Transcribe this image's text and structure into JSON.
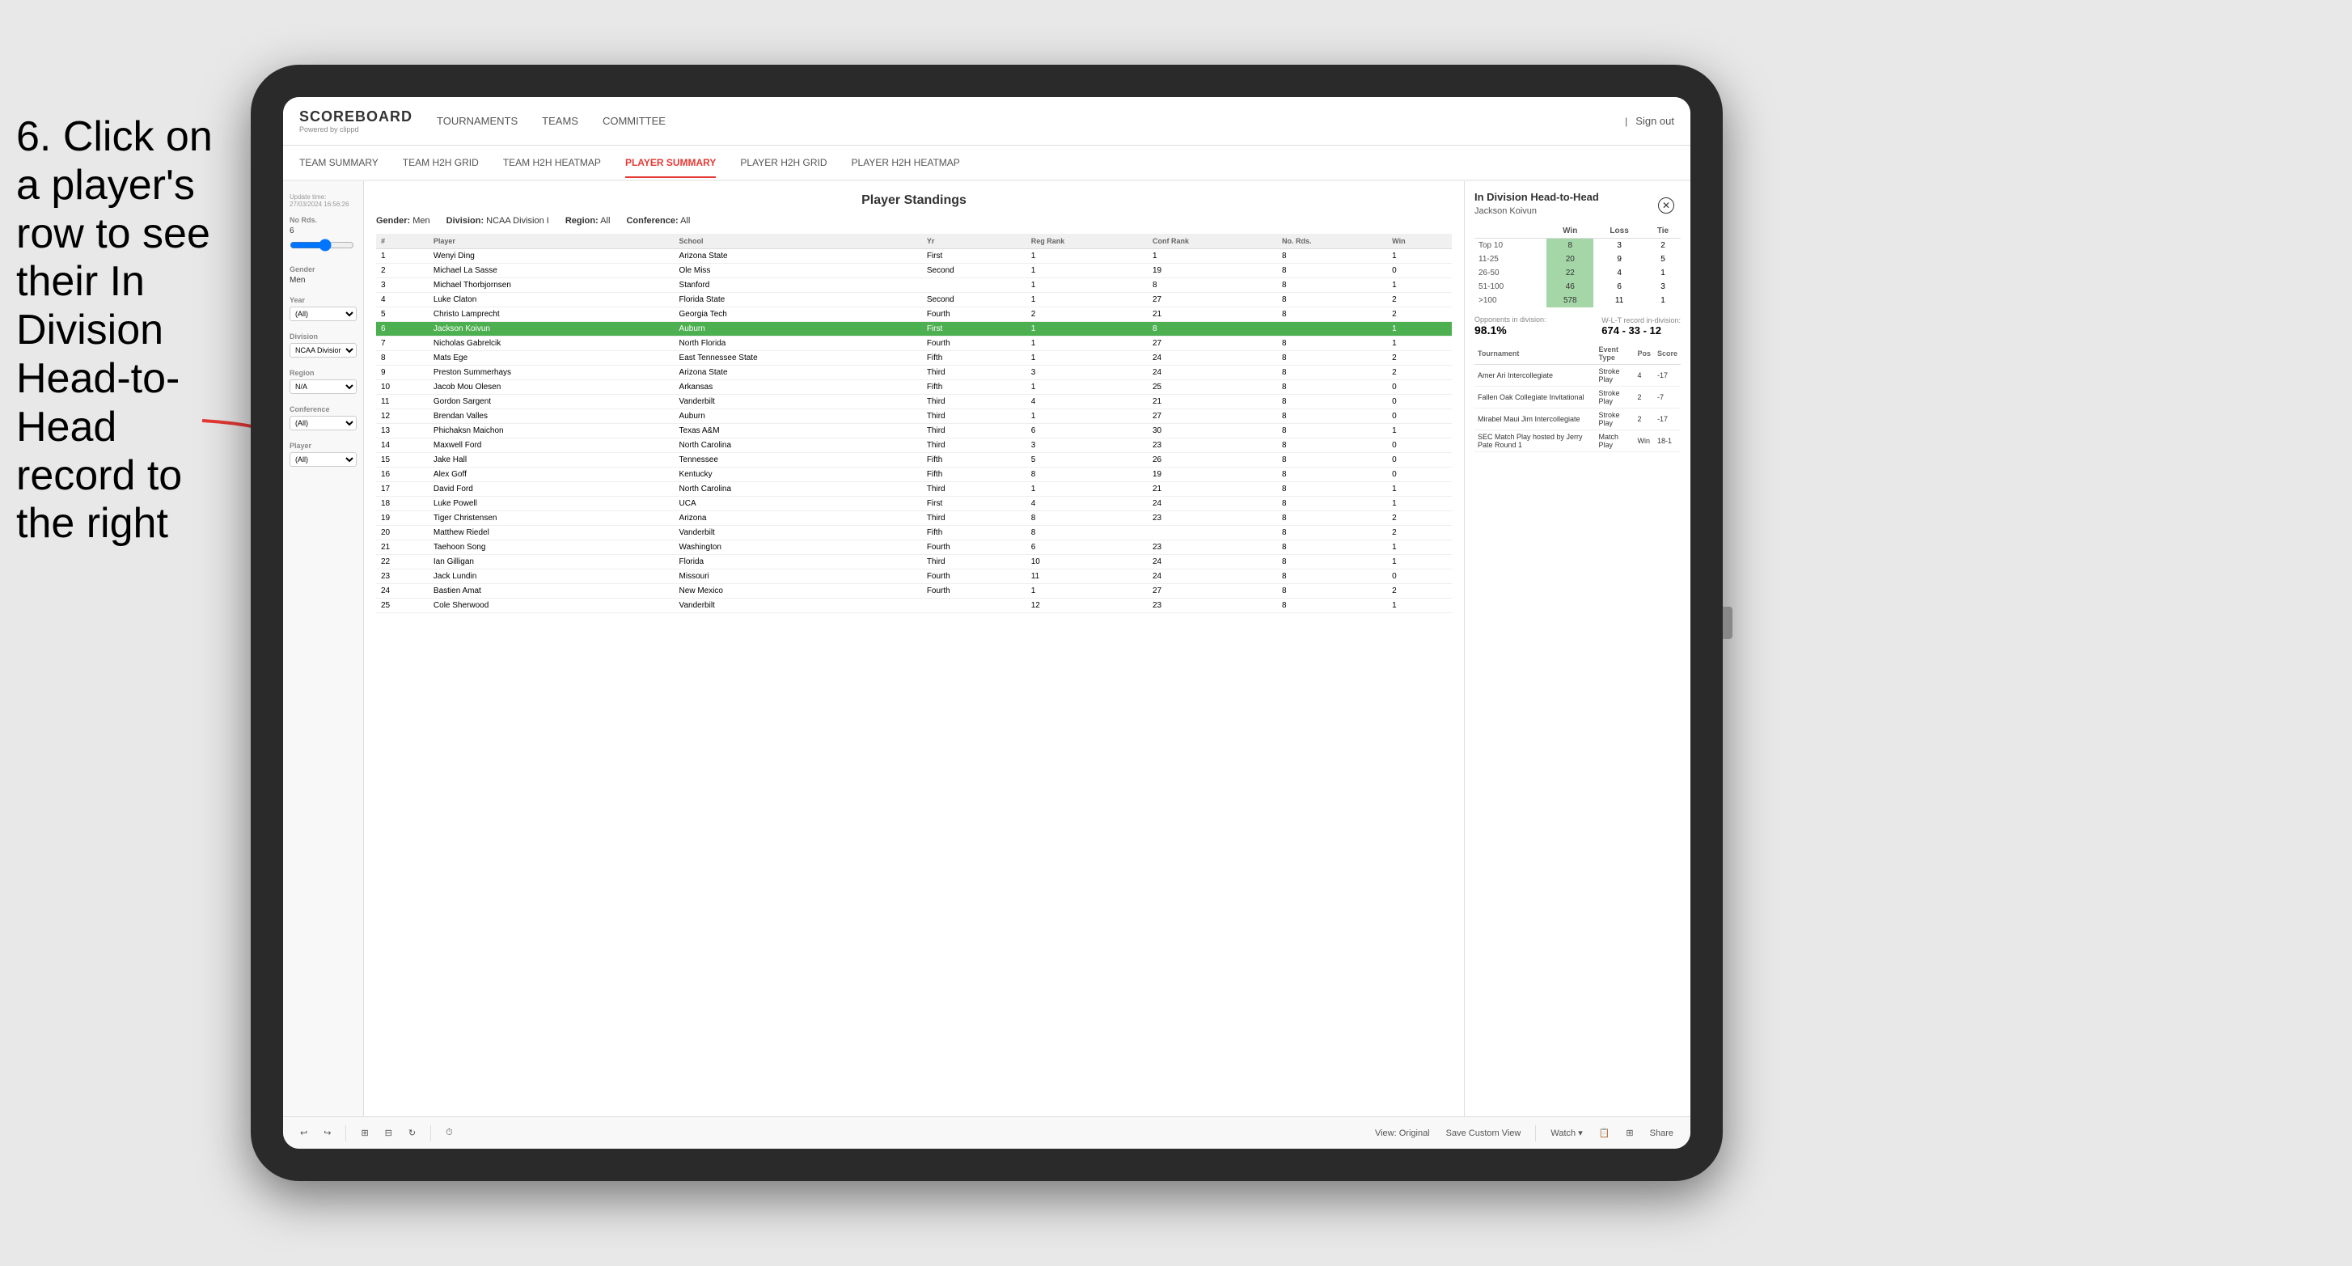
{
  "instruction": {
    "text": "6. Click on a player's row to see their In Division Head-to-Head record to the right"
  },
  "nav": {
    "logo": "SCOREBOARD",
    "logo_sub": "Powered by clippd",
    "items": [
      "TOURNAMENTS",
      "TEAMS",
      "COMMITTEE"
    ],
    "sign_out": "Sign out"
  },
  "sub_nav": {
    "items": [
      "TEAM SUMMARY",
      "TEAM H2H GRID",
      "TEAM H2H HEATMAP",
      "PLAYER SUMMARY",
      "PLAYER H2H GRID",
      "PLAYER H2H HEATMAP"
    ],
    "active": "PLAYER SUMMARY"
  },
  "sidebar": {
    "update_label": "Update time:",
    "update_time": "27/03/2024 16:56:26",
    "no_rds_label": "No Rds.",
    "no_rds_value": "6",
    "gender_label": "Gender",
    "gender_value": "Men",
    "year_label": "Year",
    "year_value": "(All)",
    "division_label": "Division",
    "division_value": "NCAA Division I",
    "region_label": "Region",
    "region_value": "N/A",
    "conference_label": "Conference",
    "conference_value": "(All)",
    "player_label": "Player",
    "player_value": "(All)"
  },
  "standings": {
    "title": "Player Standings",
    "gender_label": "Gender:",
    "gender_value": "Men",
    "division_label": "Division:",
    "division_value": "NCAA Division I",
    "region_label": "Region:",
    "region_value": "All",
    "conference_label": "Conference:",
    "conference_value": "All",
    "columns": [
      "#",
      "Player",
      "School",
      "Yr",
      "Reg Rank",
      "Conf Rank",
      "No. Rds.",
      "Win"
    ],
    "rows": [
      {
        "num": 1,
        "player": "Wenyi Ding",
        "school": "Arizona State",
        "yr": "First",
        "reg": 1,
        "conf": 1,
        "rds": 8,
        "win": 1
      },
      {
        "num": 2,
        "player": "Michael La Sasse",
        "school": "Ole Miss",
        "yr": "Second",
        "reg": 1,
        "conf": 19,
        "rds": 8,
        "win": 0
      },
      {
        "num": 3,
        "player": "Michael Thorbjornsen",
        "school": "Stanford",
        "yr": "",
        "reg": 1,
        "conf": 8,
        "rds": 8,
        "win": 1
      },
      {
        "num": 4,
        "player": "Luke Claton",
        "school": "Florida State",
        "yr": "Second",
        "reg": 1,
        "conf": 27,
        "rds": 8,
        "win": 2
      },
      {
        "num": 5,
        "player": "Christo Lamprecht",
        "school": "Georgia Tech",
        "yr": "Fourth",
        "reg": 2,
        "conf": 21,
        "rds": 8,
        "win": 2
      },
      {
        "num": 6,
        "player": "Jackson Koivun",
        "school": "Auburn",
        "yr": "First",
        "reg": 1,
        "conf": 8,
        "rds": "",
        "win": 1
      },
      {
        "num": 7,
        "player": "Nicholas Gabrelcik",
        "school": "North Florida",
        "yr": "Fourth",
        "reg": 1,
        "conf": 27,
        "rds": 8,
        "win": 1
      },
      {
        "num": 8,
        "player": "Mats Ege",
        "school": "East Tennessee State",
        "yr": "Fifth",
        "reg": 1,
        "conf": 24,
        "rds": 8,
        "win": 2
      },
      {
        "num": 9,
        "player": "Preston Summerhays",
        "school": "Arizona State",
        "yr": "Third",
        "reg": 3,
        "conf": 24,
        "rds": 8,
        "win": 2
      },
      {
        "num": 10,
        "player": "Jacob Mou Olesen",
        "school": "Arkansas",
        "yr": "Fifth",
        "reg": 1,
        "conf": 25,
        "rds": 8,
        "win": 0
      },
      {
        "num": 11,
        "player": "Gordon Sargent",
        "school": "Vanderbilt",
        "yr": "Third",
        "reg": 4,
        "conf": 21,
        "rds": 8,
        "win": 0
      },
      {
        "num": 12,
        "player": "Brendan Valles",
        "school": "Auburn",
        "yr": "Third",
        "reg": 1,
        "conf": 27,
        "rds": 8,
        "win": 0
      },
      {
        "num": 13,
        "player": "Phichaksn Maichon",
        "school": "Texas A&M",
        "yr": "Third",
        "reg": 6,
        "conf": 30,
        "rds": 8,
        "win": 1
      },
      {
        "num": 14,
        "player": "Maxwell Ford",
        "school": "North Carolina",
        "yr": "Third",
        "reg": 3,
        "conf": 23,
        "rds": 8,
        "win": 0
      },
      {
        "num": 15,
        "player": "Jake Hall",
        "school": "Tennessee",
        "yr": "Fifth",
        "reg": 5,
        "conf": 26,
        "rds": 8,
        "win": 0
      },
      {
        "num": 16,
        "player": "Alex Goff",
        "school": "Kentucky",
        "yr": "Fifth",
        "reg": 8,
        "conf": 19,
        "rds": 8,
        "win": 0
      },
      {
        "num": 17,
        "player": "David Ford",
        "school": "North Carolina",
        "yr": "Third",
        "reg": 1,
        "conf": 21,
        "rds": 8,
        "win": 1
      },
      {
        "num": 18,
        "player": "Luke Powell",
        "school": "UCA",
        "yr": "First",
        "reg": 4,
        "conf": 24,
        "rds": 8,
        "win": 1
      },
      {
        "num": 19,
        "player": "Tiger Christensen",
        "school": "Arizona",
        "yr": "Third",
        "reg": 8,
        "conf": 23,
        "rds": 8,
        "win": 2
      },
      {
        "num": 20,
        "player": "Matthew Riedel",
        "school": "Vanderbilt",
        "yr": "Fifth",
        "reg": 8,
        "conf": "",
        "rds": 8,
        "win": 2
      },
      {
        "num": 21,
        "player": "Taehoon Song",
        "school": "Washington",
        "yr": "Fourth",
        "reg": 6,
        "conf": 23,
        "rds": 8,
        "win": 1
      },
      {
        "num": 22,
        "player": "Ian Gilligan",
        "school": "Florida",
        "yr": "Third",
        "reg": 10,
        "conf": 24,
        "rds": 8,
        "win": 1
      },
      {
        "num": 23,
        "player": "Jack Lundin",
        "school": "Missouri",
        "yr": "Fourth",
        "reg": 11,
        "conf": 24,
        "rds": 8,
        "win": 0
      },
      {
        "num": 24,
        "player": "Bastien Amat",
        "school": "New Mexico",
        "yr": "Fourth",
        "reg": 1,
        "conf": 27,
        "rds": 8,
        "win": 2
      },
      {
        "num": 25,
        "player": "Cole Sherwood",
        "school": "Vanderbilt",
        "yr": "",
        "reg": 12,
        "conf": 23,
        "rds": 8,
        "win": 1
      }
    ]
  },
  "h2h_panel": {
    "title": "In Division Head-to-Head",
    "player_name": "Jackson Koivun",
    "table_headers": [
      "Win",
      "Loss",
      "Tie"
    ],
    "rows": [
      {
        "rank": "Top 10",
        "win": 8,
        "loss": 3,
        "tie": 2,
        "win_highlighted": true
      },
      {
        "rank": "11-25",
        "win": 20,
        "loss": 9,
        "tie": 5,
        "win_highlighted": true
      },
      {
        "rank": "26-50",
        "win": 22,
        "loss": 4,
        "tie": 1,
        "win_highlighted": true
      },
      {
        "rank": "51-100",
        "win": 46,
        "loss": 6,
        "tie": 3,
        "win_highlighted": true
      },
      {
        "rank": ">100",
        "win": 578,
        "loss": 11,
        "tie": 1,
        "win_highlighted": true
      }
    ],
    "opponents_label": "Opponents in division:",
    "wlt_label": "W-L-T record in-division:",
    "opponents_pct": "98.1%",
    "wlt_record": "674 - 33 - 12",
    "tournaments_headers": [
      "Tournament",
      "Event Type",
      "Pos",
      "Score"
    ],
    "tournaments": [
      {
        "name": "Amer Ari Intercollegiate",
        "type": "Stroke Play",
        "pos": 4,
        "score": "-17"
      },
      {
        "name": "Fallen Oak Collegiate Invitational",
        "type": "Stroke Play",
        "pos": 2,
        "score": "-7"
      },
      {
        "name": "Mirabel Maui Jim Intercollegiate",
        "type": "Stroke Play",
        "pos": 2,
        "score": "-17"
      },
      {
        "name": "SEC Match Play hosted by Jerry Pate Round 1",
        "type": "Match Play",
        "pos": "Win",
        "score": "18-1"
      }
    ]
  },
  "toolbar": {
    "undo": "↩",
    "redo": "↪",
    "view_original": "View: Original",
    "save_custom": "Save Custom View",
    "watch": "Watch ▾",
    "share": "Share"
  }
}
